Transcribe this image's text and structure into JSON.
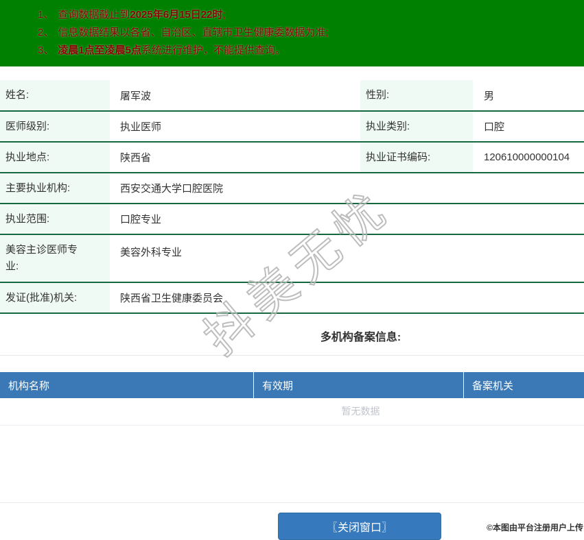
{
  "colors": {
    "banner_bg": "#008000",
    "banner_text": "#8b0000",
    "row_border_green": "#15673e",
    "label_cell_bg": "#eefaf3",
    "filing_header_bg": "#3a79b5",
    "button_bg": "#3779bd",
    "empty_text_gray": "#c0c4cc"
  },
  "banner": {
    "notes": [
      {
        "num": "1、",
        "pre": "查询数据截止到",
        "bold": "2025年6月15日22时",
        "post": ";"
      },
      {
        "num": "2、",
        "pre": "信息数据结果以各省、自治区、直辖市卫生健康委数据为准;",
        "bold": "",
        "post": ""
      },
      {
        "num": "3、",
        "pre": "",
        "bold": "凌晨1点至凌晨5点",
        "post": "系统进行维护，不能提供查询。"
      }
    ]
  },
  "profile": {
    "rows2": [
      {
        "l1": "姓名:",
        "v1": "屠军波",
        "l2": "性别:",
        "v2": "男"
      },
      {
        "l1": "医师级别:",
        "v1": "执业医师",
        "l2": "执业类别:",
        "v2": "口腔"
      },
      {
        "l1": "执业地点:",
        "v1": "陕西省",
        "l2": "执业证书编码:",
        "v2": "120610000000104"
      }
    ],
    "rows1": [
      {
        "label": "主要执业机构:",
        "value": "西安交通大学口腔医院"
      },
      {
        "label": "执业范围:",
        "value": "口腔专业"
      },
      {
        "label": "美容主诊医师专业:",
        "value": "美容外科专业"
      },
      {
        "label": "发证(批准)机关:",
        "value": "陕西省卫生健康委员会"
      }
    ]
  },
  "filing": {
    "title": "多机构备案信息:",
    "columns": [
      "机构名称",
      "有效期",
      "备案机关"
    ],
    "empty_text": "暂无数据"
  },
  "footer": {
    "close_button": "〖关闭窗口〗",
    "credit": "©本图由平台注册用户上传"
  },
  "watermark": {
    "text": "抖美无忧"
  }
}
